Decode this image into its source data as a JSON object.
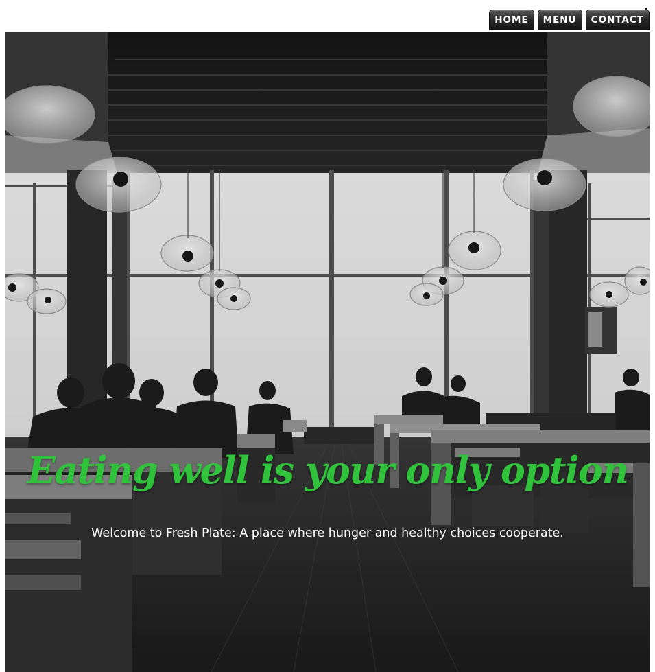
{
  "nav": {
    "items": [
      {
        "label": "HOME"
      },
      {
        "label": "MENU"
      },
      {
        "label": "CONTACT"
      }
    ]
  },
  "hero": {
    "headline": "Eating well is your only option",
    "tagline": "Welcome to Fresh Plate: A place where hunger and healthy choices cooperate.",
    "headline_color": "#2fc23a",
    "image": "restaurant-interior-photo"
  }
}
